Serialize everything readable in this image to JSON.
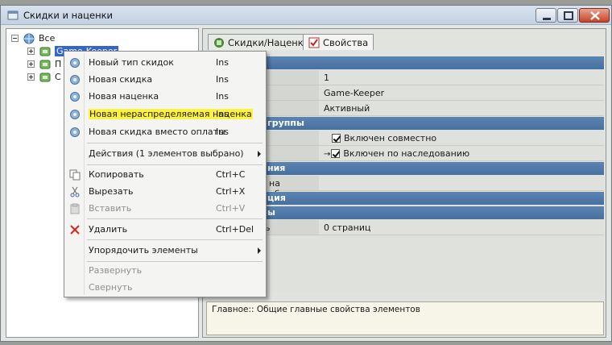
{
  "window": {
    "title": "Скидки и наценки"
  },
  "tree": {
    "root": "Все",
    "items": [
      {
        "label": "Game-Keeper",
        "selected": true
      },
      {
        "label": "П"
      },
      {
        "label": "С"
      }
    ]
  },
  "tabs": [
    {
      "label": "Скидки/Наценки",
      "active": false
    },
    {
      "label": "Свойства",
      "active": true
    }
  ],
  "properties": {
    "rows": [
      {
        "kind": "value",
        "name": "",
        "value": "1"
      },
      {
        "kind": "value",
        "name": "",
        "value": "Game-Keeper"
      },
      {
        "kind": "value",
        "name": "",
        "value": "Активный"
      },
      {
        "kind": "category",
        "label": "группы"
      },
      {
        "kind": "check",
        "name": "но",
        "value": "Включен совместно"
      },
      {
        "kind": "check",
        "name": "",
        "value": "Включен по наследованию"
      },
      {
        "kind": "category",
        "label": "ния"
      },
      {
        "kind": "value",
        "name": "на объект",
        "value": ""
      },
      {
        "kind": "category",
        "label": "ция"
      },
      {
        "kind": "category",
        "label": "ы"
      },
      {
        "kind": "value",
        "name": "ль",
        "value": "0 страниц"
      }
    ]
  },
  "description": "Главное:: Общие главные свойства элементов",
  "context_menu": {
    "items": [
      {
        "label": "Новый тип скидок",
        "shortcut": "Ins"
      },
      {
        "label": "Новая скидка",
        "shortcut": "Ins"
      },
      {
        "label": "Новая наценка",
        "shortcut": "Ins"
      },
      {
        "label": "Новая нераспределяемая наценка",
        "shortcut": "Ins"
      },
      {
        "label": "Новая скидка вместо оплаты",
        "shortcut": "Ins"
      },
      {
        "label": "Действия (1 элементов выбрано)"
      },
      {
        "label": "Копировать",
        "shortcut": "Ctrl+C"
      },
      {
        "label": "Вырезать",
        "shortcut": "Ctrl+X"
      },
      {
        "label": "Вставить",
        "shortcut": "Ctrl+V"
      },
      {
        "label": "Удалить",
        "shortcut": "Ctrl+Del"
      },
      {
        "label": "Упорядочить элементы"
      },
      {
        "label": "Развернуть"
      },
      {
        "label": "Свернуть"
      }
    ]
  },
  "colors": {
    "category_header": "#5077a8",
    "selection": "#3366cc",
    "highlight": "#fff23a"
  }
}
